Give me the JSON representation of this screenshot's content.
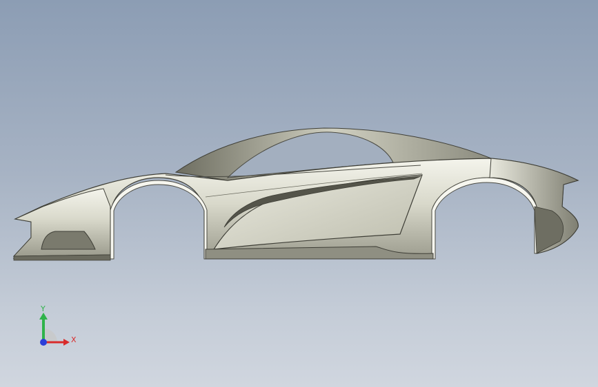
{
  "viewport": {
    "background_top": "#8c9db4",
    "background_bottom": "#d0d6df",
    "body_color": "#d4d4c6",
    "shadow_color": "#5e5e54"
  },
  "triad": {
    "x_label": "X",
    "y_label": "Y",
    "x_color": "#d92b2b",
    "y_color": "#2fb34a",
    "z_color": "#2b3fd9"
  }
}
